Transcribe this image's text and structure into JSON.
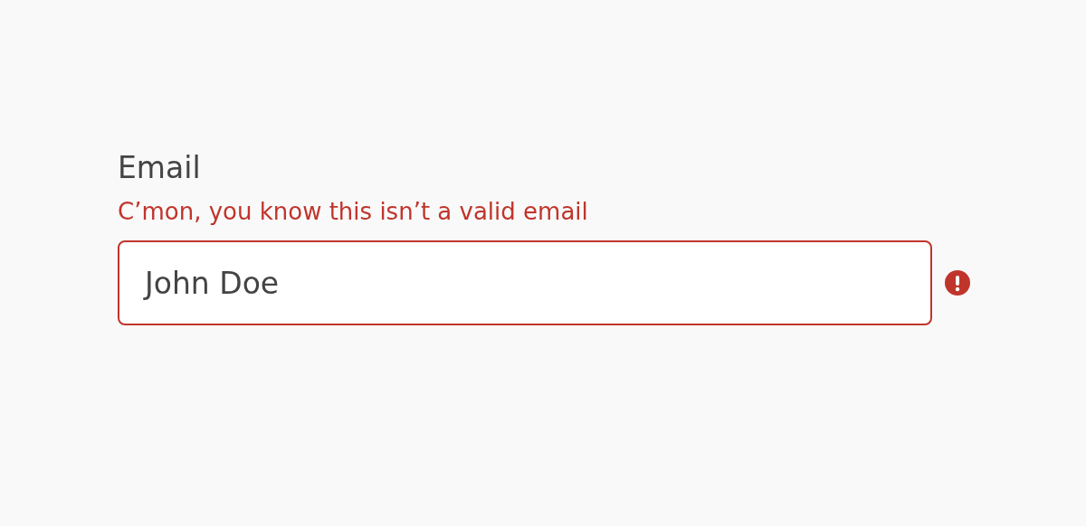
{
  "field": {
    "label": "Email",
    "error": "C’mon, you know this isn’t a valid email",
    "value": "John Doe",
    "invalid": true
  }
}
